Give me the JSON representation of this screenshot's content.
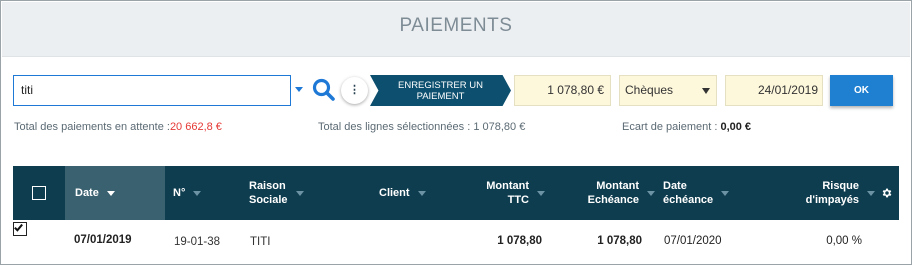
{
  "header": {
    "title": "PAIEMENTS"
  },
  "toolbar": {
    "search_value": "titi",
    "register_label_line1": "ENREGISTRER UN",
    "register_label_line2": "PAIEMENT",
    "amount": "1 078,80 €",
    "payment_method": "Chèques",
    "payment_date": "24/01/2019",
    "ok_label": "OK",
    "more_label": "⋮"
  },
  "summary": {
    "pending_label": "Total des paiements en attente :",
    "pending_value": "20 662,8 €",
    "selected_label": "Total des lignes sélectionnées :",
    "selected_value": "1 078,80 €",
    "gap_label": "Ecart de paiement :",
    "gap_value": "0,00 €"
  },
  "table": {
    "columns": {
      "date": "Date",
      "num": "N°",
      "raison_line1": "Raison",
      "raison_line2": "Sociale",
      "client": "Client",
      "ttc_line1": "Montant",
      "ttc_line2": "TTC",
      "ech_line1": "Montant",
      "ech_line2": "Echéance",
      "dech_line1": "Date",
      "dech_line2": "échéance",
      "risk_line1": "Risque",
      "risk_line2": "d'impayés"
    },
    "rows": [
      {
        "date": "07/01/2019",
        "num": "19-01-38",
        "raison": "TITI",
        "client": "",
        "ttc": "1 078,80",
        "echeance": "1 078,80",
        "date_echeance": "07/01/2020",
        "risque": "0,00 %",
        "checked": true
      }
    ]
  },
  "colors": {
    "header_bg": "#eceff1",
    "table_head_bg": "#0e3d4f",
    "accent_blue": "#1f7fd0",
    "register_btn": "#0d4f6e",
    "field_bg": "#fdf7dc",
    "pending_value_color": "#e53935"
  },
  "icons": {
    "search": "search-icon",
    "more": "more-vertical-icon",
    "settings": "gear-icon",
    "sort": "sort-down-icon",
    "checkbox": "checkbox-icon"
  }
}
